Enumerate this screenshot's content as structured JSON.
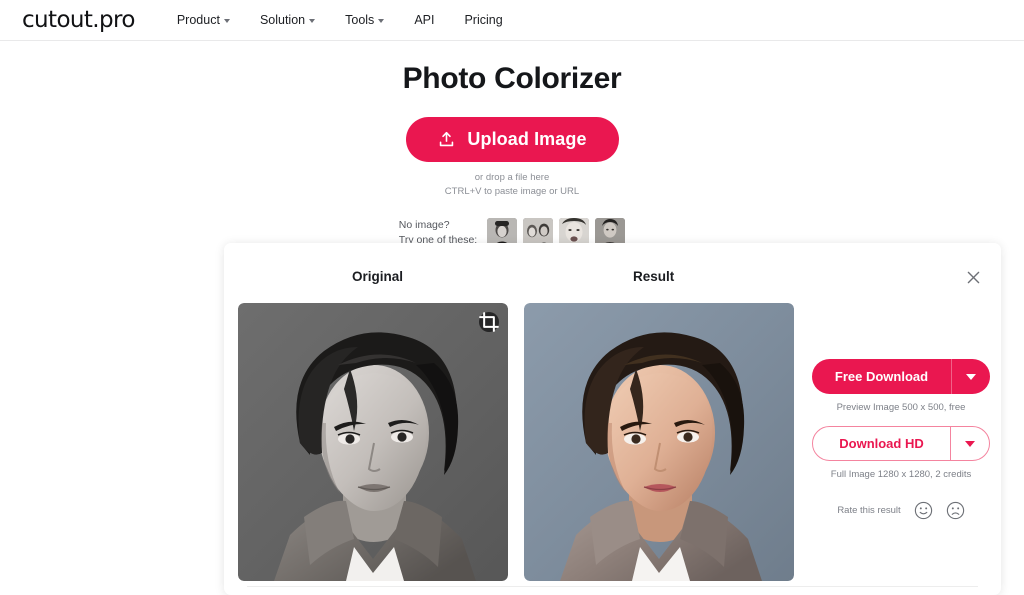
{
  "brand": {
    "logo": "cutout.pro",
    "accent_color": "#ea1750",
    "accent_light": "#f4849f"
  },
  "nav": {
    "items": [
      {
        "label": "Product",
        "has_dropdown": true
      },
      {
        "label": "Solution",
        "has_dropdown": true
      },
      {
        "label": "Tools",
        "has_dropdown": true
      },
      {
        "label": "API",
        "has_dropdown": false
      },
      {
        "label": "Pricing",
        "has_dropdown": false
      }
    ]
  },
  "hero": {
    "title": "Photo Colorizer",
    "upload_button": "Upload Image",
    "upload_icon": "upload-icon",
    "drop_hint_line1": "or drop a file here",
    "drop_hint_line2": "CTRL+V to paste image or URL"
  },
  "samples": {
    "text_line1": "No image?",
    "text_line2": "Try one of these:",
    "thumbnails": [
      {
        "name": "sample-thumbnail-1"
      },
      {
        "name": "sample-thumbnail-2"
      },
      {
        "name": "sample-thumbnail-3"
      },
      {
        "name": "sample-thumbnail-4"
      }
    ]
  },
  "panel": {
    "label_original": "Original",
    "label_result": "Result",
    "close_icon": "close-icon",
    "crop_icon": "crop-icon",
    "original_image_alt": "black-and-white portrait of young man",
    "result_image_alt": "colorized portrait of young man"
  },
  "actions": {
    "free_download": {
      "label": "Free Download",
      "caret_icon": "chevron-down-icon",
      "note": "Preview Image 500 x 500, free"
    },
    "download_hd": {
      "label": "Download HD",
      "caret_icon": "chevron-down-icon",
      "note": "Full Image 1280 x 1280, 2 credits"
    },
    "rate": {
      "label": "Rate this result",
      "positive_icon": "smiley-happy-icon",
      "negative_icon": "smiley-sad-icon"
    }
  }
}
